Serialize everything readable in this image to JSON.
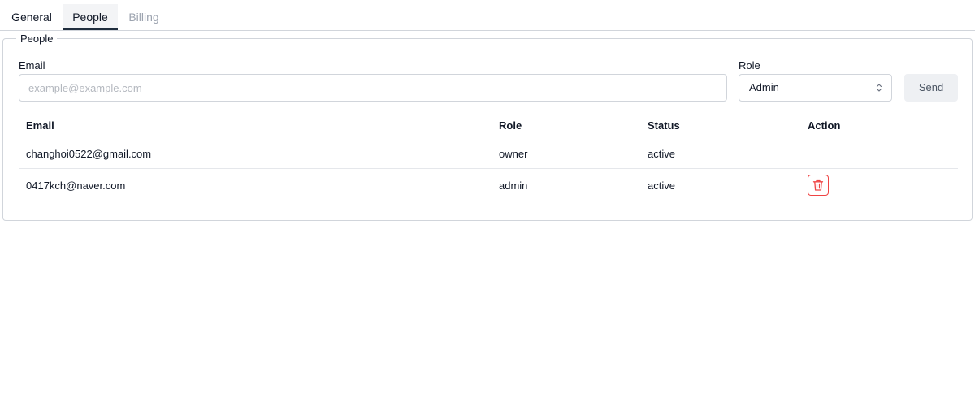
{
  "tabs": [
    {
      "label": "General",
      "active": false,
      "disabled": false
    },
    {
      "label": "People",
      "active": true,
      "disabled": false
    },
    {
      "label": "Billing",
      "active": false,
      "disabled": true
    }
  ],
  "section": {
    "legend": "People"
  },
  "invite_form": {
    "email_label": "Email",
    "email_placeholder": "example@example.com",
    "email_value": "",
    "role_label": "Role",
    "role_value": "Admin",
    "send_label": "Send"
  },
  "table": {
    "columns": [
      "Email",
      "Role",
      "Status",
      "Action"
    ],
    "rows": [
      {
        "email": "changhoi0522@gmail.com",
        "role": "owner",
        "status": "active",
        "action": ""
      },
      {
        "email": "0417kch@naver.com",
        "role": "admin",
        "status": "active",
        "action": "delete-icon"
      }
    ]
  },
  "colors": {
    "active_tab_underline": "#1f2d3d",
    "disabled_tab_text": "#9ca3af",
    "delete_accent": "#ef4444",
    "send_button_bg": "#eef0f3"
  }
}
